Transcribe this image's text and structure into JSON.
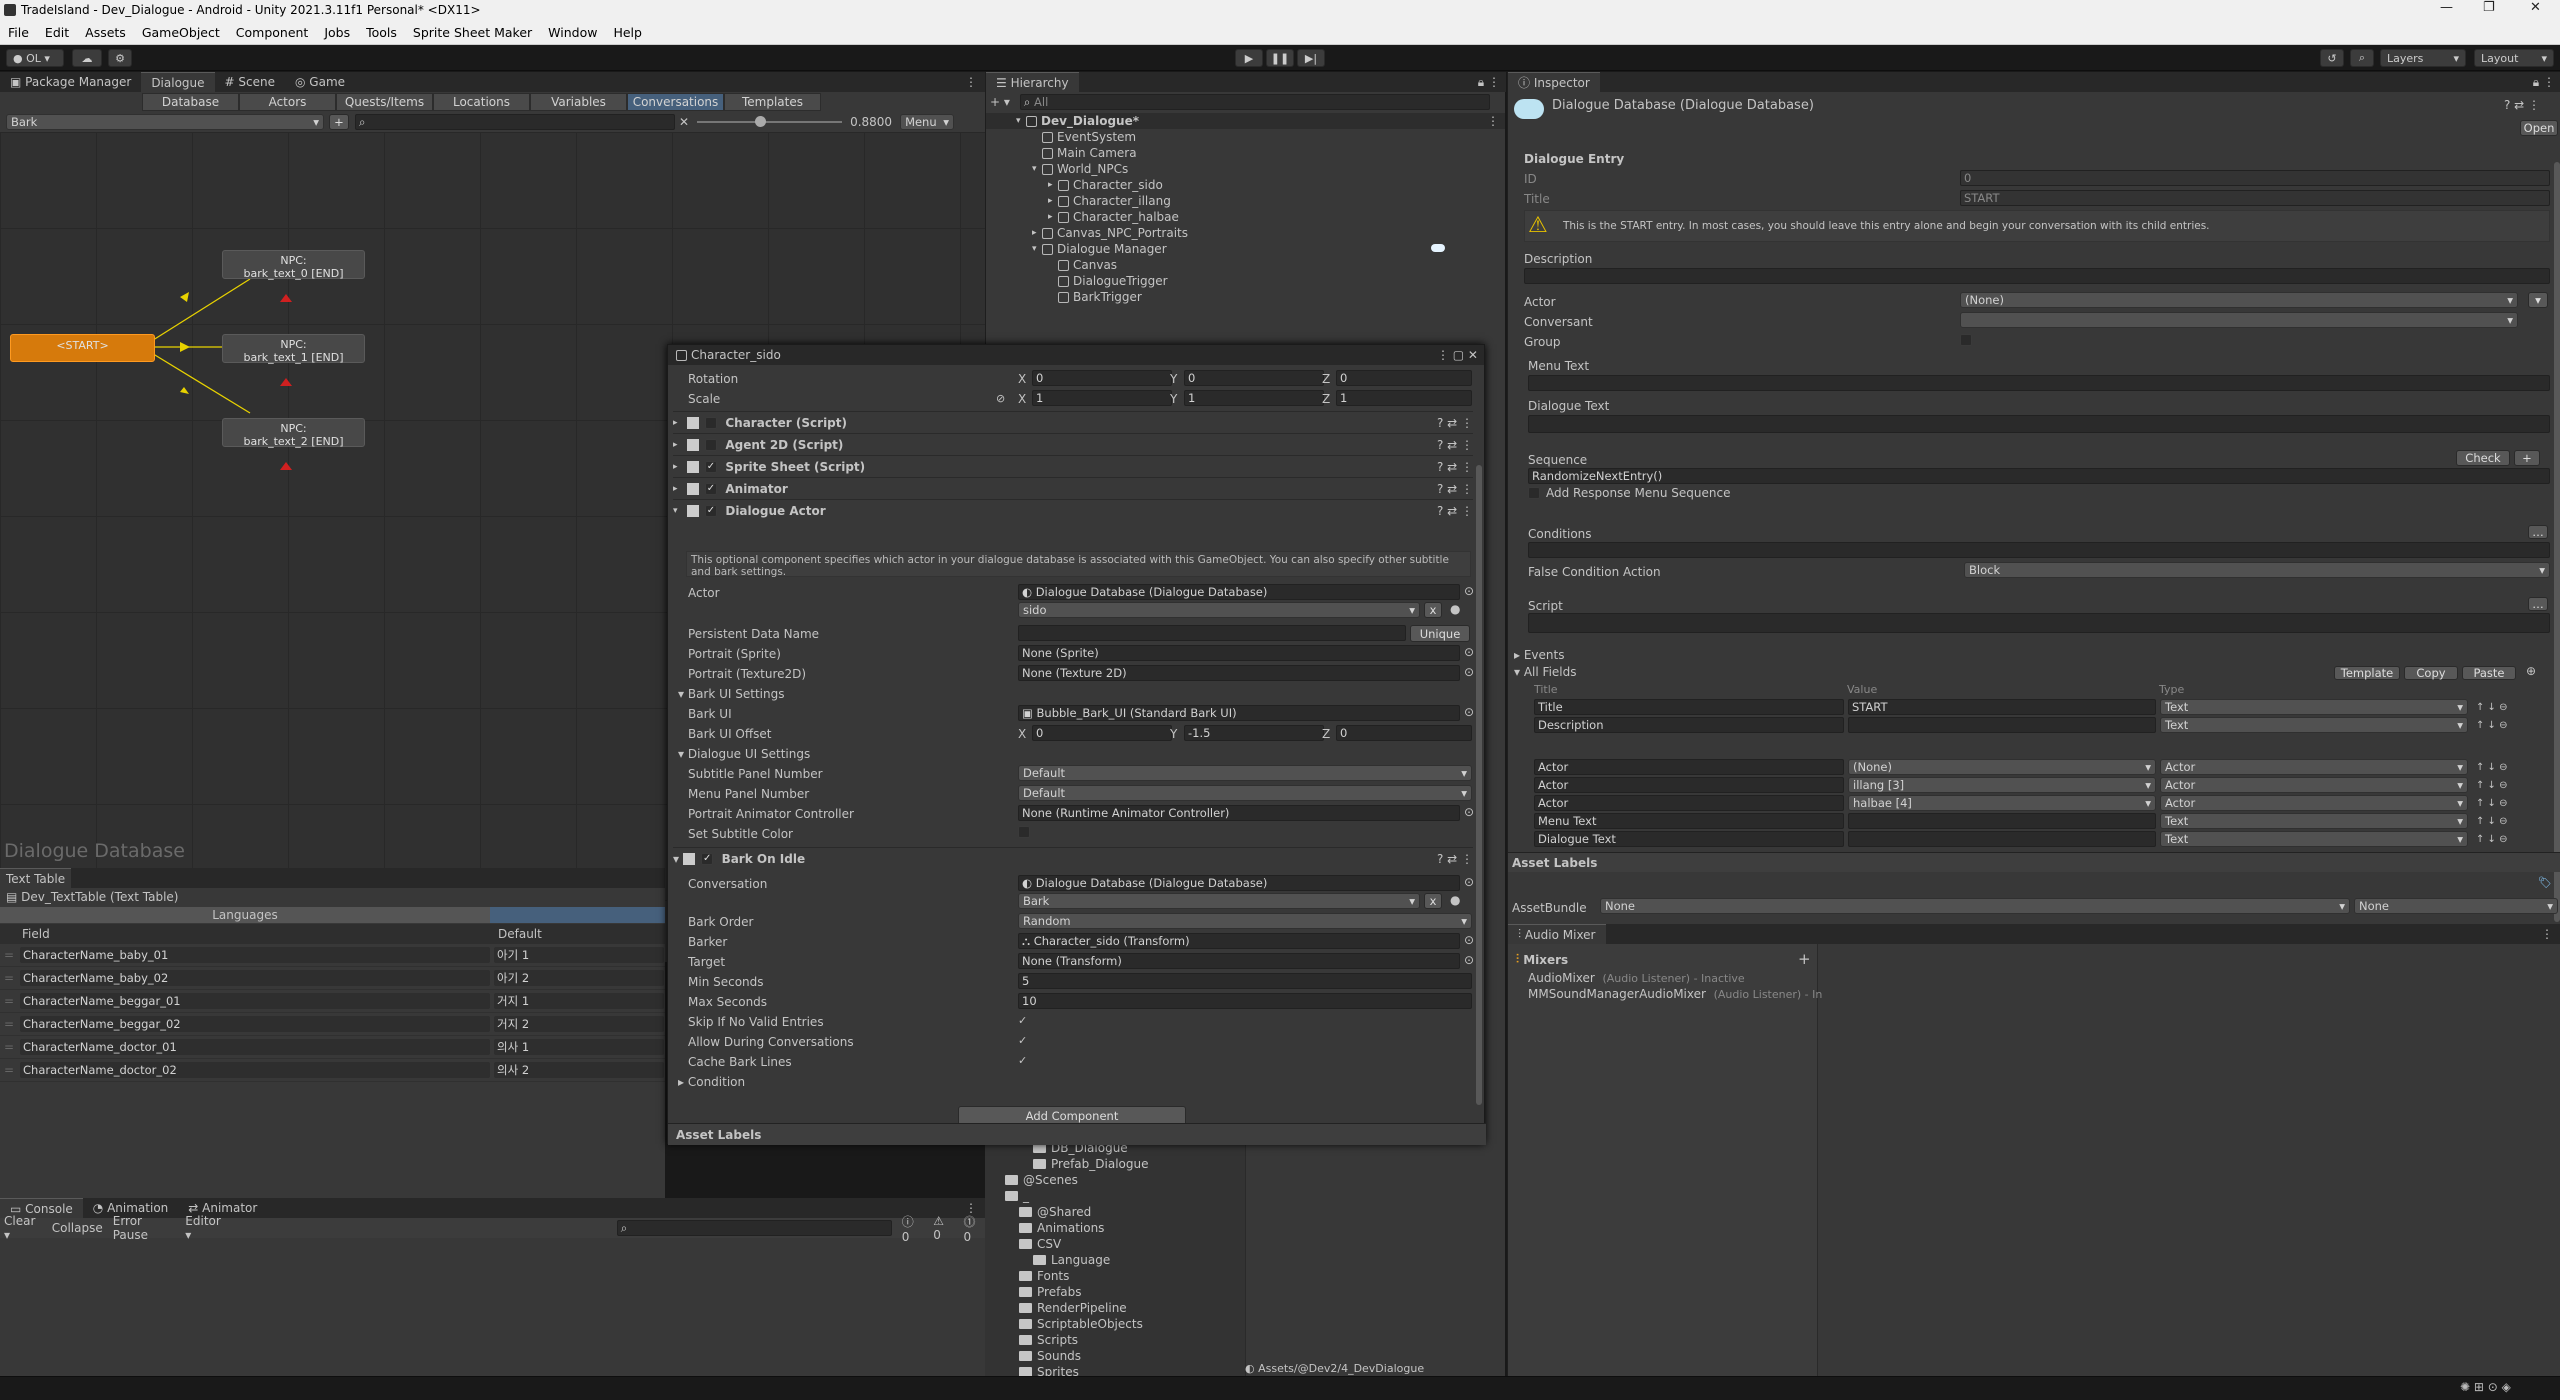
{
  "window": {
    "title": "TradeIsland - Dev_Dialogue - Android - Unity 2021.3.11f1 Personal* <DX11>"
  },
  "menu": [
    "File",
    "Edit",
    "Assets",
    "GameObject",
    "Component",
    "Jobs",
    "Tools",
    "Sprite Sheet Maker",
    "Window",
    "Help"
  ],
  "toolbar": {
    "account": "OL",
    "layers": "Layers",
    "layout": "Layout"
  },
  "left_tabs": [
    "Package Manager",
    "Dialogue",
    "Scene",
    "Game"
  ],
  "dialogue": {
    "subtabs": [
      "Database",
      "Actors",
      "Quests/Items",
      "Locations",
      "Variables",
      "Conversations",
      "Templates"
    ],
    "selected_subtab": "Conversations",
    "conversation": "Bark",
    "zoom": "0.8800",
    "menu_label": "Menu",
    "start_node": "<START>",
    "nodes": [
      {
        "l1": "NPC:",
        "l2": "bark_text_0 [END]"
      },
      {
        "l1": "NPC:",
        "l2": "bark_text_1 [END]"
      },
      {
        "l1": "NPC:",
        "l2": "bark_text_2 [END]"
      }
    ],
    "db_watermark": "Dialogue Database"
  },
  "texttable": {
    "tab": "Text Table",
    "name": "Dev_TextTable (Text Table)",
    "languages_header": "Languages",
    "field_header": "Field",
    "default_header": "Default",
    "rows": [
      {
        "field": "CharacterName_baby_01",
        "value": "아기 1"
      },
      {
        "field": "CharacterName_baby_02",
        "value": "아기 2"
      },
      {
        "field": "CharacterName_beggar_01",
        "value": "거지 1"
      },
      {
        "field": "CharacterName_beggar_02",
        "value": "거지 2"
      },
      {
        "field": "CharacterName_doctor_01",
        "value": "의사 1"
      },
      {
        "field": "CharacterName_doctor_02",
        "value": "의사 2"
      }
    ]
  },
  "console": {
    "tabs": [
      "Console",
      "Animation",
      "Animator"
    ],
    "buttons": [
      "Clear",
      "Collapse",
      "Error Pause",
      "Editor"
    ],
    "counts": [
      "0",
      "0",
      "0"
    ]
  },
  "hierarchy": {
    "tab": "Hierarchy",
    "search_placeholder": "All",
    "items": [
      {
        "label": "Dev_Dialogue*",
        "indent": 0
      },
      {
        "label": "EventSystem",
        "indent": 1
      },
      {
        "label": "Main Camera",
        "indent": 1
      },
      {
        "label": "World_NPCs",
        "indent": 1
      },
      {
        "label": "Character_sido",
        "indent": 2
      },
      {
        "label": "Character_illang",
        "indent": 2
      },
      {
        "label": "Character_halbae",
        "indent": 2
      },
      {
        "label": "Canvas_NPC_Portraits",
        "indent": 1
      },
      {
        "label": "Dialogue Manager",
        "indent": 1
      },
      {
        "label": "Canvas",
        "indent": 2
      },
      {
        "label": "DialogueTrigger",
        "indent": 2
      },
      {
        "label": "BarkTrigger",
        "indent": 2
      }
    ]
  },
  "project": {
    "items": [
      "DB_Dialogue",
      "Prefab_Dialogue",
      "@Scenes",
      "_",
      "@Shared",
      "Animations",
      "CSV",
      "Language",
      "Fonts",
      "Prefabs",
      "RenderPipeline",
      "ScriptableObjects",
      "Scripts",
      "Sounds",
      "Sprites"
    ],
    "path": "Assets/@Dev2/4_DevDialogue"
  },
  "floating": {
    "title": "Character_sido",
    "rotation": {
      "label": "Rotation",
      "x": "0",
      "y": "0",
      "z": "0"
    },
    "scale": {
      "label": "Scale",
      "x": "1",
      "y": "1",
      "z": "1"
    },
    "components": [
      "Character (Script)",
      "Agent 2D (Script)",
      "Sprite Sheet (Script)",
      "Animator",
      "Dialogue Actor"
    ],
    "help": "This optional component specifies which actor in your dialogue database is associated with this GameObject. You can also specify other subtitle and bark settings.",
    "actor_label": "Actor",
    "actor_db": "Dialogue Database (Dialogue Database)",
    "actor_value": "sido",
    "persistent_label": "Persistent Data Name",
    "unique_btn": "Unique",
    "portrait_sprite_label": "Portrait (Sprite)",
    "portrait_sprite": "None (Sprite)",
    "portrait_tex_label": "Portrait (Texture2D)",
    "portrait_tex": "None (Texture 2D)",
    "bark_ui_settings": "Bark UI Settings",
    "bark_ui_label": "Bark UI",
    "bark_ui": "Bubble_Bark_UI (Standard Bark UI)",
    "bark_offset_label": "Bark UI Offset",
    "bark_offset": {
      "x": "0",
      "y": "-1.5",
      "z": "0"
    },
    "dlg_ui_settings": "Dialogue UI Settings",
    "subtitle_panel_label": "Subtitle Panel Number",
    "subtitle_panel": "Default",
    "menu_panel_label": "Menu Panel Number",
    "menu_panel": "Default",
    "portrait_anim_label": "Portrait Animator Controller",
    "portrait_anim": "None (Runtime Animator Controller)",
    "set_subtitle_color": "Set Subtitle Color",
    "bark_on_idle": "Bark On Idle",
    "conversation_label": "Conversation",
    "conversation_db": "Dialogue Database (Dialogue Database)",
    "conversation_value": "Bark",
    "bark_order_label": "Bark Order",
    "bark_order": "Random",
    "barker_label": "Barker",
    "barker": "Character_sido (Transform)",
    "target_label": "Target",
    "target": "None (Transform)",
    "min_seconds_label": "Min Seconds",
    "min_seconds": "5",
    "max_seconds_label": "Max Seconds",
    "max_seconds": "10",
    "skip_label": "Skip If No Valid Entries",
    "allow_label": "Allow During Conversations",
    "cache_label": "Cache Bark Lines",
    "condition_label": "Condition",
    "add_component": "Add Component",
    "asset_labels": "Asset Labels"
  },
  "inspector": {
    "tab": "Inspector",
    "title": "Dialogue Database (Dialogue Database)",
    "open_btn": "Open",
    "section": "Dialogue Entry",
    "id_label": "ID",
    "id_value": "0",
    "title_label": "Title",
    "title_value": "START",
    "warning": "This is the START entry. In most cases, you should leave this entry alone and begin your conversation with its child entries.",
    "description_label": "Description",
    "actor_label": "Actor",
    "actor_value": "(None)",
    "conversant_label": "Conversant",
    "group_label": "Group",
    "menu_text_label": "Menu Text",
    "dialogue_text_label": "Dialogue Text",
    "sequence_label": "Sequence",
    "check_btn": "Check",
    "sequence_value": "RandomizeNextEntry()",
    "add_response": "Add Response Menu Sequence",
    "conditions_label": "Conditions",
    "false_cond_label": "False Condition Action",
    "false_cond_value": "Block",
    "script_label": "Script",
    "events_label": "Events",
    "all_fields_label": "All Fields",
    "template_btn": "Template",
    "copy_btn": "Copy",
    "paste_btn": "Paste",
    "col_title": "Title",
    "col_value": "Value",
    "col_type": "Type",
    "fields": [
      {
        "title": "Title",
        "value": "START",
        "type": "Text"
      },
      {
        "title": "Description",
        "value": "",
        "type": "Text"
      },
      {
        "title": "Actor",
        "value": "(None)",
        "type": "Actor"
      },
      {
        "title": "Actor",
        "value": "illang [3]",
        "type": "Actor"
      },
      {
        "title": "Actor",
        "value": "halbae [4]",
        "type": "Actor"
      },
      {
        "title": "Menu Text",
        "value": "",
        "type": "Text"
      },
      {
        "title": "Dialogue Text",
        "value": "",
        "type": "Text"
      }
    ],
    "asset_labels": "Asset Labels",
    "assetbundle_label": "AssetBundle",
    "assetbundle_value": "None",
    "assetbundle_variant": "None"
  },
  "audio": {
    "tab": "Audio Mixer",
    "mixers_label": "Mixers",
    "mixers": [
      {
        "name": "AudioMixer",
        "note": "(Audio Listener) - Inactive"
      },
      {
        "name": "MMSoundManagerAudioMixer",
        "note": "(Audio Listener) - In"
      }
    ]
  }
}
